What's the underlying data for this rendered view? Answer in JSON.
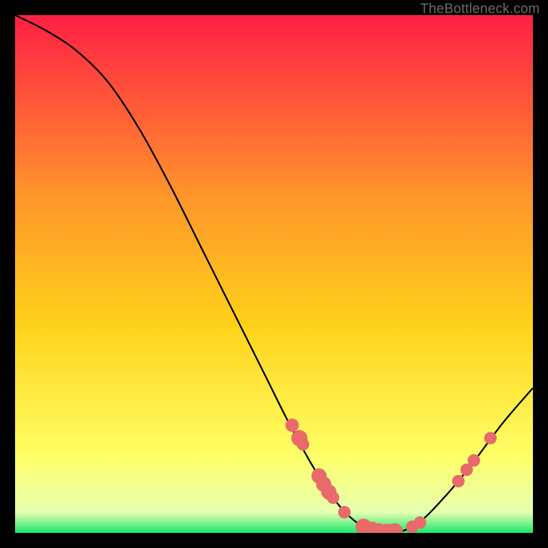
{
  "watermark": "TheBottleneck.com",
  "colors": {
    "gradient_top": "#ff1f44",
    "gradient_mid1": "#ff7d2e",
    "gradient_mid2": "#ffd21a",
    "gradient_mid3": "#ffff3a",
    "gradient_bottom": "#19e86a",
    "curve": "#000000",
    "markers": "#e86a6a",
    "frame": "#000000"
  },
  "chart_data": {
    "type": "line",
    "title": "",
    "xlabel": "",
    "ylabel": "",
    "xlim": [
      0,
      100
    ],
    "ylim": [
      0,
      100
    ],
    "curve": [
      {
        "x": 0,
        "y": 100
      },
      {
        "x": 6,
        "y": 97
      },
      {
        "x": 12,
        "y": 93
      },
      {
        "x": 18,
        "y": 87
      },
      {
        "x": 24,
        "y": 78
      },
      {
        "x": 30,
        "y": 67
      },
      {
        "x": 36,
        "y": 55
      },
      {
        "x": 42,
        "y": 43
      },
      {
        "x": 48,
        "y": 31
      },
      {
        "x": 53,
        "y": 21
      },
      {
        "x": 58,
        "y": 12
      },
      {
        "x": 62,
        "y": 6
      },
      {
        "x": 66,
        "y": 2
      },
      {
        "x": 70,
        "y": 0.2
      },
      {
        "x": 74,
        "y": 0.2
      },
      {
        "x": 78,
        "y": 2
      },
      {
        "x": 83,
        "y": 7
      },
      {
        "x": 88,
        "y": 13
      },
      {
        "x": 94,
        "y": 21
      },
      {
        "x": 100,
        "y": 28
      }
    ],
    "markers": [
      {
        "x": 53.5,
        "y": 20.8,
        "r": 1.0
      },
      {
        "x": 54.9,
        "y": 18.3,
        "r": 1.3
      },
      {
        "x": 55.6,
        "y": 17.1,
        "r": 0.9
      },
      {
        "x": 58.7,
        "y": 11.0,
        "r": 1.2
      },
      {
        "x": 59.6,
        "y": 9.4,
        "r": 1.2
      },
      {
        "x": 60.6,
        "y": 7.9,
        "r": 1.2
      },
      {
        "x": 61.4,
        "y": 6.8,
        "r": 0.9
      },
      {
        "x": 63.6,
        "y": 4.0,
        "r": 0.9
      },
      {
        "x": 67.3,
        "y": 1.2,
        "r": 1.3
      },
      {
        "x": 68.9,
        "y": 0.6,
        "r": 1.3
      },
      {
        "x": 70.3,
        "y": 0.3,
        "r": 1.3
      },
      {
        "x": 71.8,
        "y": 0.2,
        "r": 1.3
      },
      {
        "x": 73.3,
        "y": 0.3,
        "r": 1.3
      },
      {
        "x": 76.7,
        "y": 1.2,
        "r": 0.9
      },
      {
        "x": 78.2,
        "y": 2.0,
        "r": 0.9
      },
      {
        "x": 85.6,
        "y": 10.0,
        "r": 0.9
      },
      {
        "x": 87.2,
        "y": 12.2,
        "r": 0.9
      },
      {
        "x": 88.6,
        "y": 14.0,
        "r": 0.9
      },
      {
        "x": 91.8,
        "y": 18.3,
        "r": 0.9
      }
    ]
  }
}
